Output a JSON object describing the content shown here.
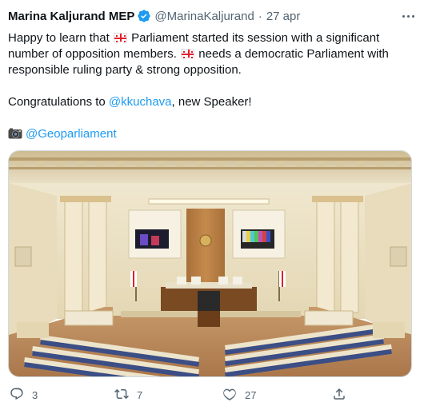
{
  "tweet": {
    "display_name": "Marina Kaljurand MEP",
    "handle": "@MarinaKaljurand",
    "separator": "·",
    "date": "27 apr",
    "line1_a": "Happy to learn that",
    "line1_b": "Parliament started its session with a significant number of opposition members.",
    "line1_c": "needs a democratic Parliament with responsible ruling party & strong opposition.",
    "line2_a": "Congratulations to",
    "mention": "@kkuchava",
    "line2_b": ", new Speaker!",
    "location_mention": "@Geoparliament"
  },
  "actions": {
    "replies": "3",
    "retweets": "7",
    "likes": "27"
  },
  "colors": {
    "accent": "#1d9bf0",
    "secondary_text": "#536471",
    "flag_red": "#e0202a"
  },
  "icons": [
    "verified-badge-icon",
    "more-icon",
    "georgia-flag-icon",
    "camera-icon",
    "reply-icon",
    "retweet-icon",
    "like-icon",
    "share-icon"
  ]
}
